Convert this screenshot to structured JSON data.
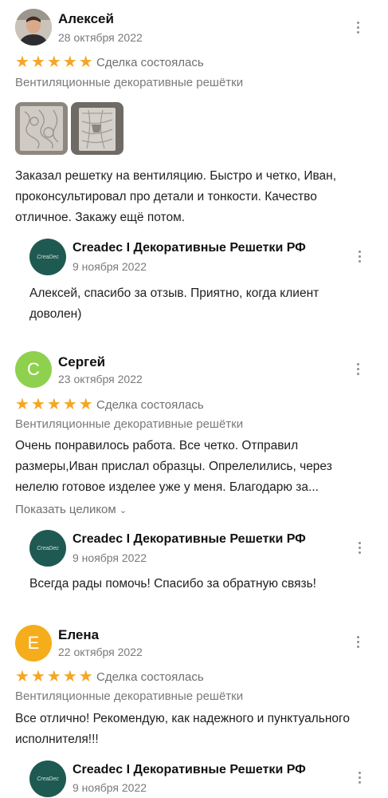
{
  "reviews": [
    {
      "author": "Алексей",
      "date": "28 октября 2022",
      "rating": 5,
      "deal_status": "Сделка состоялась",
      "category": "Вентиляционные декоративные решётки",
      "text": "Заказал решетку на вентиляцию. Быстро и четко, Иван, проконсультировал про детали и тонкости. Качество отличное. Закажу ещё потом.",
      "reply": {
        "author": "Creadec I Декоративные Решетки РФ",
        "date": "9 ноября 2022",
        "text": "Алексей, спасибо за отзыв. Приятно, когда клиент доволен)"
      }
    },
    {
      "author": "Сергей",
      "avatar_letter": "С",
      "avatar_color": "#8fd14f",
      "date": "23 октября 2022",
      "rating": 5,
      "deal_status": "Сделка состоялась",
      "category": "Вентиляционные декоративные решётки",
      "text": "Очень понравилось работа. Все четко. Отправил размеры,Иван прислал образцы. Опрелелились, через нелелю готовое изделее уже у меня. Благодарю за...",
      "show_more": "Показать целиком",
      "reply": {
        "author": "Creadec I Декоративные Решетки РФ",
        "date": "9 ноября 2022",
        "text": "Всегда рады помочь! Спасибо за обратную связь!"
      }
    },
    {
      "author": "Елена",
      "avatar_letter": "Е",
      "avatar_color": "#f5ad1b",
      "date": "22 октября 2022",
      "rating": 5,
      "deal_status": "Сделка состоялась",
      "category": "Вентиляционные декоративные решётки",
      "text": "Все отлично! Рекомендую, как надежного и пунктуального исполнителя!!!",
      "reply": {
        "author": "Creadec I Декоративные Решетки РФ",
        "date": "9 ноября 2022"
      }
    }
  ],
  "brand_logo_text": "CreaDec",
  "star_color": "#f5a623"
}
